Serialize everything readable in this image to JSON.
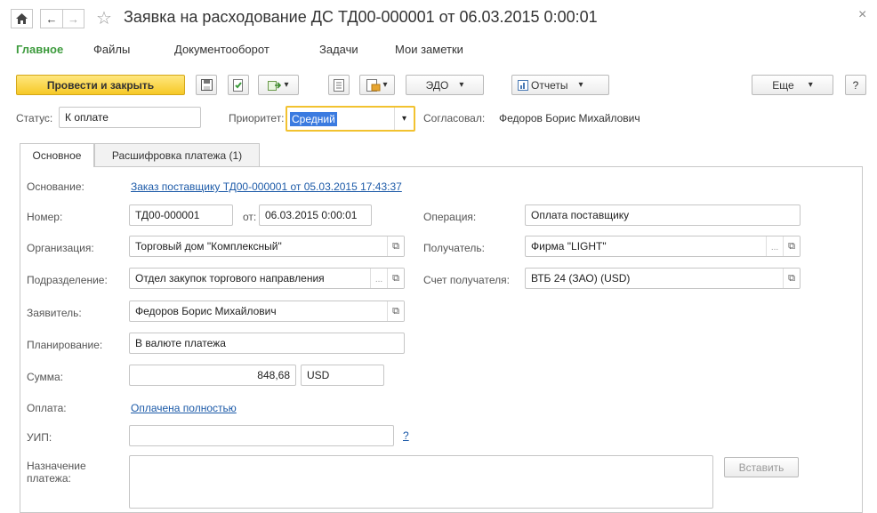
{
  "window": {
    "title": "Заявка на расходование ДС ТД00-000001 от 06.03.2015 0:00:01",
    "close_glyph": "×"
  },
  "nav": {
    "home_glyph": "🏠",
    "back_glyph": "←",
    "forward_glyph": "→",
    "star_glyph": "☆"
  },
  "menu": {
    "items": [
      "Главное",
      "Файлы",
      "Документооборот",
      "Задачи",
      "Мои заметки"
    ],
    "active_color": "#3d9b3d"
  },
  "toolbar": {
    "post_close_label": "Провести и закрыть",
    "edo_label": "ЭДО",
    "reports_label": "Отчеты",
    "more_label": "Еще",
    "help_label": "?",
    "dropdown_glyph": "▾"
  },
  "status_row": {
    "status_label": "Статус:",
    "status_value": "К оплате",
    "priority_label": "Приоритет:",
    "priority_value": "Средний",
    "approved_label": "Согласовал:",
    "approved_value": "Федоров Борис Михайлович"
  },
  "tabs": [
    {
      "label": "Основное"
    },
    {
      "label": "Расшифровка платежа (1)"
    }
  ],
  "form": {
    "basis_label": "Основание:",
    "basis_link": "Заказ поставщику ТД00-000001 от 05.03.2015 17:43:37",
    "number_label": "Номер:",
    "number_value": "ТД00-000001",
    "date_label": "от:",
    "date_value": "06.03.2015  0:00:01",
    "operation_label": "Операция:",
    "operation_value": "Оплата поставщику",
    "org_label": "Организация:",
    "org_value": "Торговый дом \"Комплексный\"",
    "recipient_label": "Получатель:",
    "recipient_value": "Фирма \"LIGHT\"",
    "division_label": "Подразделение:",
    "division_value": "Отдел закупок торгового направления",
    "recipient_account_label": "Счет получателя:",
    "recipient_account_value": "ВТБ 24 (ЗАО) (USD)",
    "applicant_label": "Заявитель:",
    "applicant_value": "Федоров Борис Михайлович",
    "planning_label": "Планирование:",
    "planning_value": "В валюте платежа",
    "amount_label": "Сумма:",
    "amount_value": "848,68",
    "currency_value": "USD",
    "payment_label": "Оплата:",
    "payment_link": "Оплачена полностью",
    "uip_label": "УИП:",
    "uip_value": "",
    "uip_help": "?",
    "purpose_label": "Назначение платежа:",
    "purpose_value": "",
    "insert_label": "Вставить",
    "dots": "...",
    "open_glyph": "⧉"
  }
}
